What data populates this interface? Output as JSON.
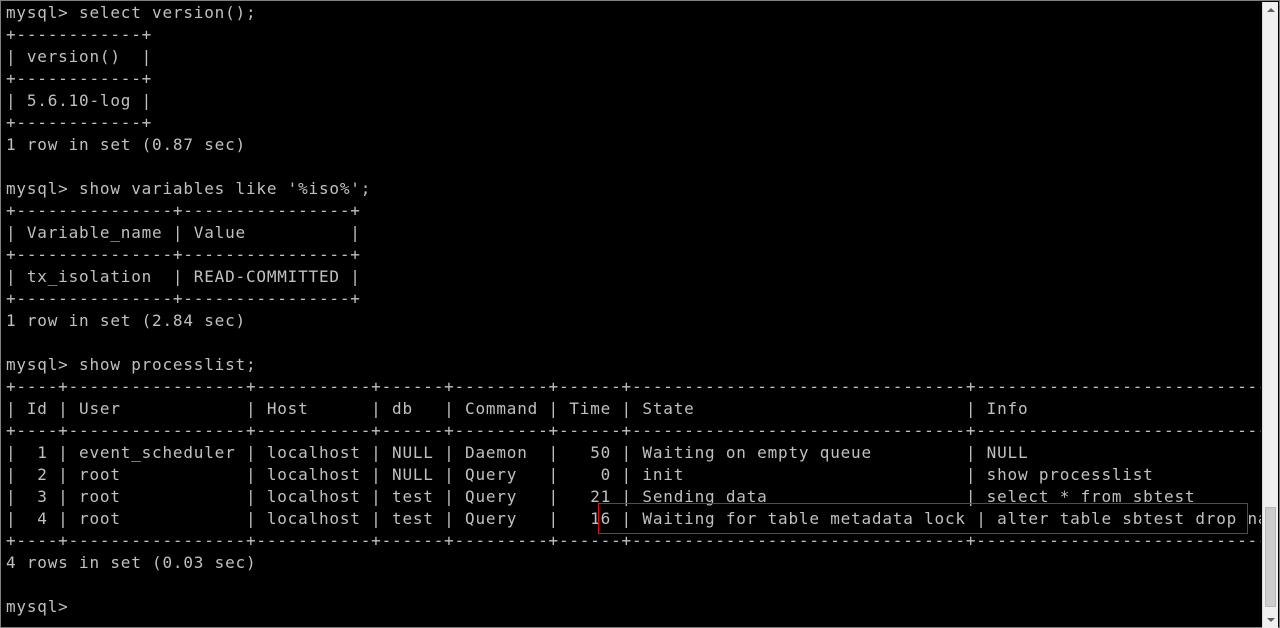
{
  "console": {
    "lines": [
      "mysql> select version();",
      "+------------+",
      "| version()  |",
      "+------------+",
      "| 5.6.10-log |",
      "+------------+",
      "1 row in set (0.87 sec)",
      "",
      "mysql> show variables like '%iso%';",
      "+---------------+----------------+",
      "| Variable_name | Value          |",
      "+---------------+----------------+",
      "| tx_isolation  | READ-COMMITTED |",
      "+---------------+----------------+",
      "1 row in set (2.84 sec)",
      "",
      "mysql> show processlist;",
      "+----+-----------------+-----------+------+---------+------+--------------------------------+-----------------------------+",
      "| Id | User            | Host      | db   | Command | Time | State                          | Info                        |",
      "+----+-----------------+-----------+------+---------+------+--------------------------------+-----------------------------+",
      "|  1 | event_scheduler | localhost | NULL | Daemon  |   50 | Waiting on empty queue         | NULL                        |",
      "|  2 | root            | localhost | NULL | Query   |    0 | init                           | show processlist            |",
      "|  3 | root            | localhost | test | Query   |   21 | Sending data                   | select * from sbtest        |",
      "|  4 | root            | localhost | test | Query   |   16 | Waiting for table metadata lock | alter table sbtest drop name |",
      "+----+-----------------+-----------+------+---------+------+--------------------------------+-----------------------------+",
      "4 rows in set (0.03 sec)",
      "",
      "mysql> "
    ]
  },
  "colors": {
    "background": "#000000",
    "text": "#c0c0c0",
    "highlight_border": "#e01010"
  }
}
